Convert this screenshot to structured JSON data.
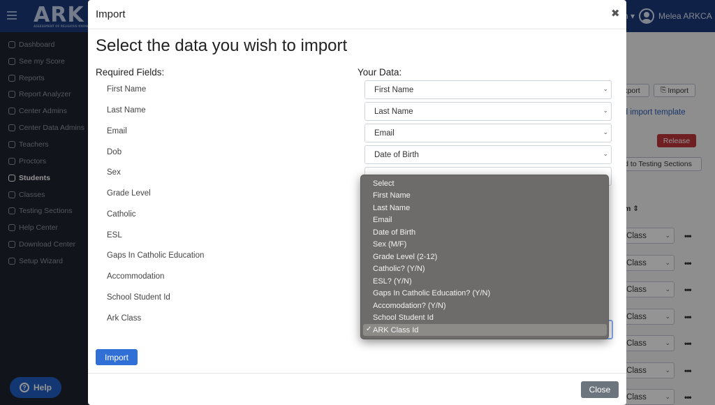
{
  "app": {
    "logo_text": "ARK",
    "logo_tagline": "ASSESSMENT OF RELIGIOUS KNOWLEDGE",
    "user_menu_partial": "n ▾",
    "user_name": "Melea ARKCA"
  },
  "sidebar": {
    "items": [
      {
        "label": "Dashboard"
      },
      {
        "label": "See my Score"
      },
      {
        "label": "Reports"
      },
      {
        "label": "Report Analyzer"
      },
      {
        "label": "Center Admins"
      },
      {
        "label": "Center Data Admins"
      },
      {
        "label": "Teachers"
      },
      {
        "label": "Proctors"
      },
      {
        "label": "Students"
      },
      {
        "label": "Classes"
      },
      {
        "label": "Testing Sections"
      },
      {
        "label": "Help Center"
      },
      {
        "label": "Download Center"
      },
      {
        "label": "Setup Wizard"
      }
    ],
    "active_index": 8,
    "help_label": "Help"
  },
  "background": {
    "export_partial": "xport",
    "import_label": "Import",
    "template_link_partial": "oad import template",
    "release_label": "Release",
    "add_to_sections_partial": "d to Testing Sections",
    "column_header_partial": "m ⇕",
    "row_select_partial": "ct Class",
    "row_dots": "•••"
  },
  "modal": {
    "title": "Import",
    "close_icon": "✖",
    "headline": "Select the data you wish to import",
    "required_header": "Required Fields:",
    "your_data_header": "Your Data:",
    "required_fields": [
      "First Name",
      "Last Name",
      "Email",
      "Dob",
      "Sex",
      "Grade Level",
      "Catholic",
      "ESL",
      "Gaps In Catholic Education",
      "Accommodation",
      "School Student Id",
      "Ark Class"
    ],
    "selects": [
      "First Name",
      "Last Name",
      "Email",
      "Date of Birth"
    ],
    "import_button": "Import",
    "close_button": "Close"
  },
  "dropdown": {
    "options": [
      "Select",
      "First Name",
      "Last Name",
      "Email",
      "Date of Birth",
      "Sex (M/F)",
      "Grade Level (2-12)",
      "Catholic? (Y/N)",
      "ESL? (Y/N)",
      "Gaps In Catholic Education? (Y/N)",
      "Accomodation? (Y/N)",
      "School Student Id",
      "ARK Class Id"
    ],
    "selected_index": 12,
    "check_mark": "✓"
  },
  "colors": {
    "primary": "#2f6fd6",
    "danger": "#c0343a",
    "secondary": "#6c757d",
    "topbar": "#1a3a7a"
  }
}
